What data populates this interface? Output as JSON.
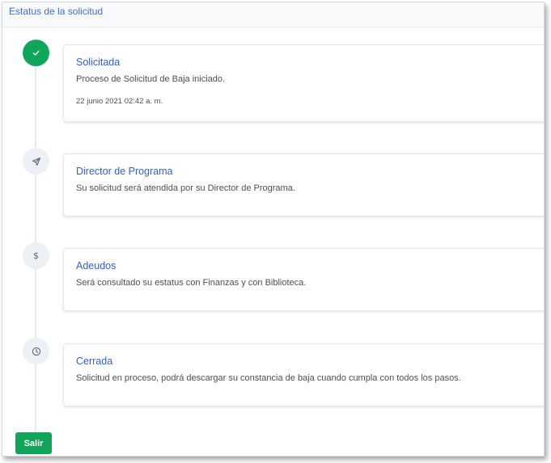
{
  "header": {
    "title": "Estatus de la solicitud"
  },
  "steps": [
    {
      "icon": "check-icon",
      "status": "done",
      "title": "Solicitada",
      "description": "Proceso de Solicitud de Baja iniciado.",
      "timestamp": "22 junio 2021 02:42 a. m."
    },
    {
      "icon": "send-icon",
      "status": "pending",
      "title": "Director de Programa",
      "description": "Su solicitud será atendida por su Director de Programa."
    },
    {
      "icon": "dollar-icon",
      "status": "pending",
      "title": "Adeudos",
      "description": "Será consultado su estatus con Finanzas y con Biblioteca."
    },
    {
      "icon": "clock-icon",
      "status": "pending",
      "title": "Cerrada",
      "description": "Solicitud en proceso, podrá descargar su constancia de baja cuando cumpla con todos los pasos."
    }
  ],
  "actions": {
    "exit_label": "Salir"
  },
  "colors": {
    "accent": "#2f5fd0",
    "success": "#10a659",
    "icon_bg": "#edf0f5"
  }
}
